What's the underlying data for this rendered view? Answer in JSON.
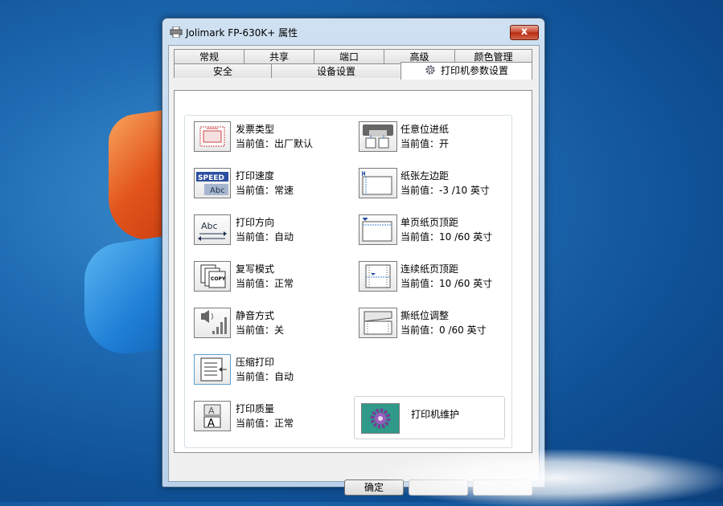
{
  "window": {
    "title": "Jolimark FP-630K+ 属性",
    "close_symbol": "x"
  },
  "tabs_row1": [
    "常规",
    "共享",
    "端口",
    "高级",
    "颜色管理"
  ],
  "tabs_row2": [
    "安全",
    "设备设置",
    "打印机参数设置"
  ],
  "active_tab": "打印机参数设置",
  "left_items": [
    {
      "label": "发票类型",
      "value": "当前值：出厂默认",
      "icon": "invoice-type-icon"
    },
    {
      "label": "打印速度",
      "value": "当前值：常速",
      "icon": "speed-icon"
    },
    {
      "label": "打印方向",
      "value": "当前值：自动",
      "icon": "direction-icon"
    },
    {
      "label": "复写模式",
      "value": "当前值：正常",
      "icon": "copy-mode-icon"
    },
    {
      "label": "静音方式",
      "value": "当前值：关",
      "icon": "mute-icon"
    },
    {
      "label": "压缩打印",
      "value": "当前值：自动",
      "icon": "compress-icon"
    },
    {
      "label": "打印质量",
      "value": "当前值：正常",
      "icon": "quality-icon"
    }
  ],
  "right_items": [
    {
      "label": "任意位进纸",
      "value": "当前值：开",
      "icon": "paper-feed-icon"
    },
    {
      "label": "纸张左边距",
      "value": "当前值：-3 /10 英寸",
      "icon": "left-margin-icon"
    },
    {
      "label": "单页纸页顶距",
      "value": "当前值：10 /60 英寸",
      "icon": "single-top-margin-icon"
    },
    {
      "label": "连续纸页顶距",
      "value": "当前值：10 /60 英寸",
      "icon": "continuous-top-margin-icon"
    },
    {
      "label": "撕纸位调整",
      "value": "当前值：0 /60 英寸",
      "icon": "tear-off-icon"
    }
  ],
  "maintenance": {
    "label": "打印机维护",
    "icon": "maintenance-gear-icon"
  },
  "buttons": {
    "ok": "确定"
  },
  "icon_text": {
    "speed": "SPEED",
    "abc": "Abc",
    "copy": "COPY",
    "a": "A"
  },
  "colors": {
    "accent": "#2f9a8a",
    "close": "#c7432a"
  }
}
